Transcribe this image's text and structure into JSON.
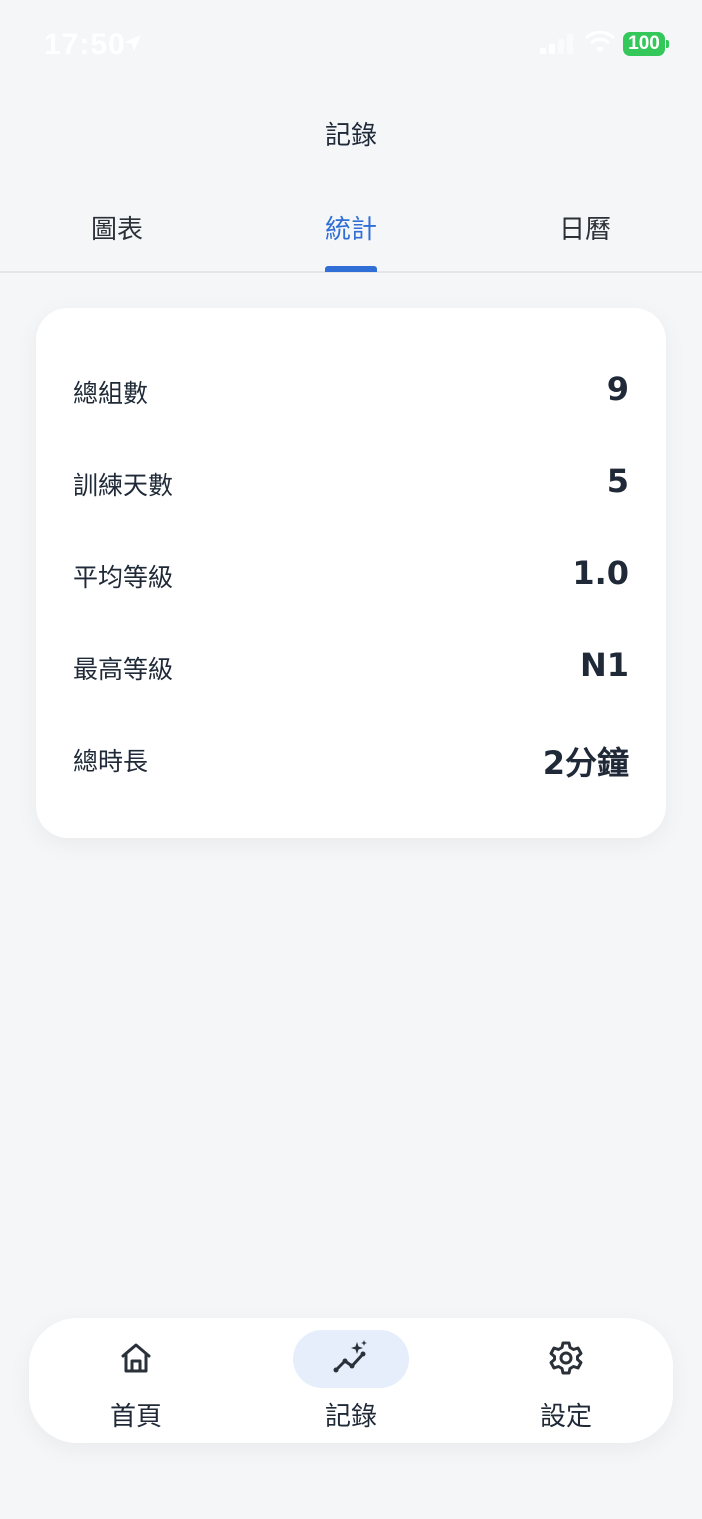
{
  "status_bar": {
    "time": "17:50",
    "battery": "100",
    "icons": [
      "location-arrow-icon",
      "cellular-signal-icon",
      "wifi-icon",
      "battery-icon"
    ],
    "battery_color": "#34c759"
  },
  "header": {
    "title": "記錄"
  },
  "tabs": [
    {
      "label": "圖表",
      "active": false
    },
    {
      "label": "統計",
      "active": true
    },
    {
      "label": "日曆",
      "active": false
    }
  ],
  "stats": [
    {
      "label": "總組數",
      "value": "9"
    },
    {
      "label": "訓練天數",
      "value": "5"
    },
    {
      "label": "平均等級",
      "value": "1.0"
    },
    {
      "label": "最高等級",
      "value": "N1"
    },
    {
      "label": "總時長",
      "value": "2分鐘"
    }
  ],
  "bottom_nav": {
    "items": [
      {
        "label": "首頁",
        "icon": "home-icon",
        "active": false
      },
      {
        "label": "記錄",
        "icon": "sparkle-chart-icon",
        "active": true
      },
      {
        "label": "設定",
        "icon": "gear-icon",
        "active": false
      }
    ]
  },
  "colors": {
    "accent": "#2f6fd6",
    "background": "#f5f6f8",
    "active_nav_bg": "#e6eefc",
    "text": "#1f2937"
  }
}
